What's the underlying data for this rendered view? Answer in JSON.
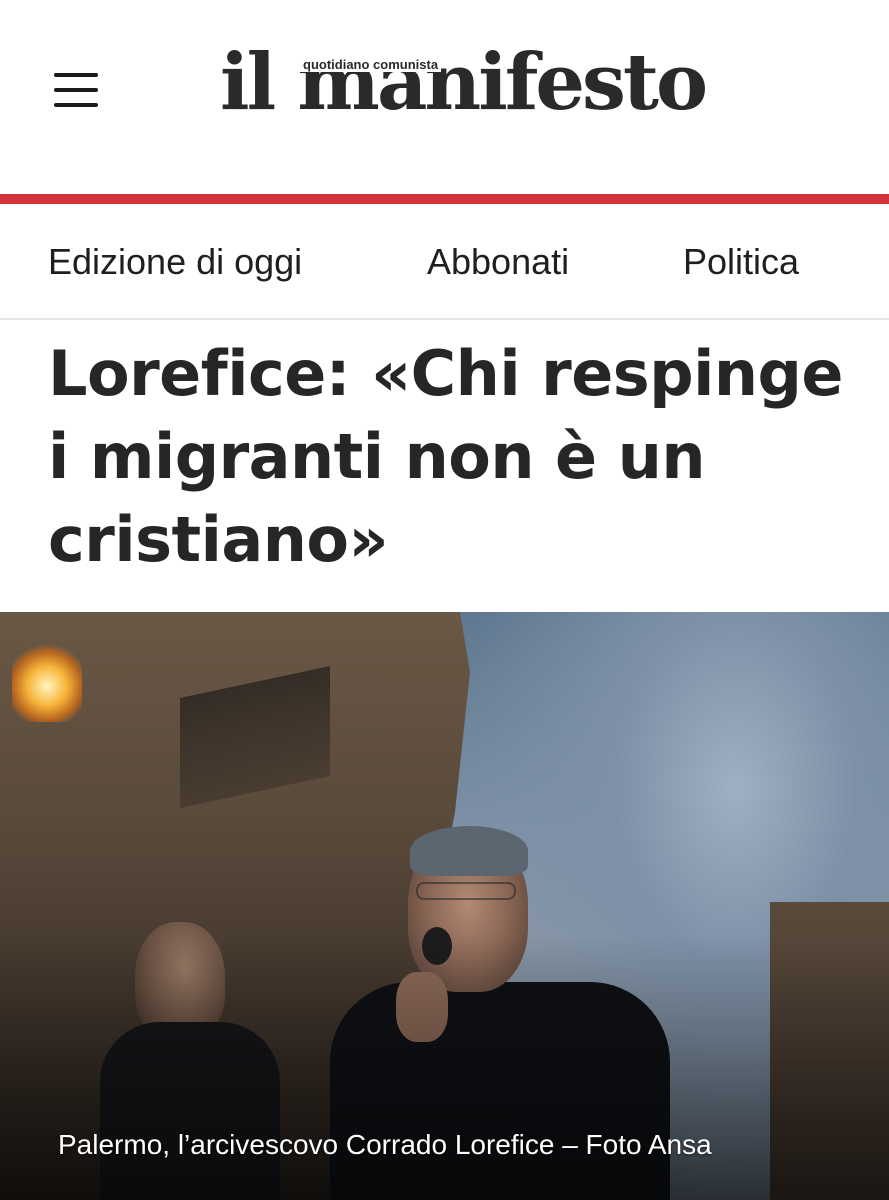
{
  "header": {
    "menu_icon": "hamburger-menu-icon",
    "logo_text": "il manifesto",
    "logo_tagline": "quotidiano comunista",
    "accent_color": "#d1333a"
  },
  "nav": {
    "items": [
      {
        "label": "Edizione di oggi"
      },
      {
        "label": "Abbonati"
      },
      {
        "label": "Politica"
      }
    ]
  },
  "article": {
    "headline": "Lorefice: «Chi respinge i migranti non è un cristiano»",
    "photo_caption": "Palermo, l’arcivescovo Corrado Lorefice – Foto Ansa"
  }
}
